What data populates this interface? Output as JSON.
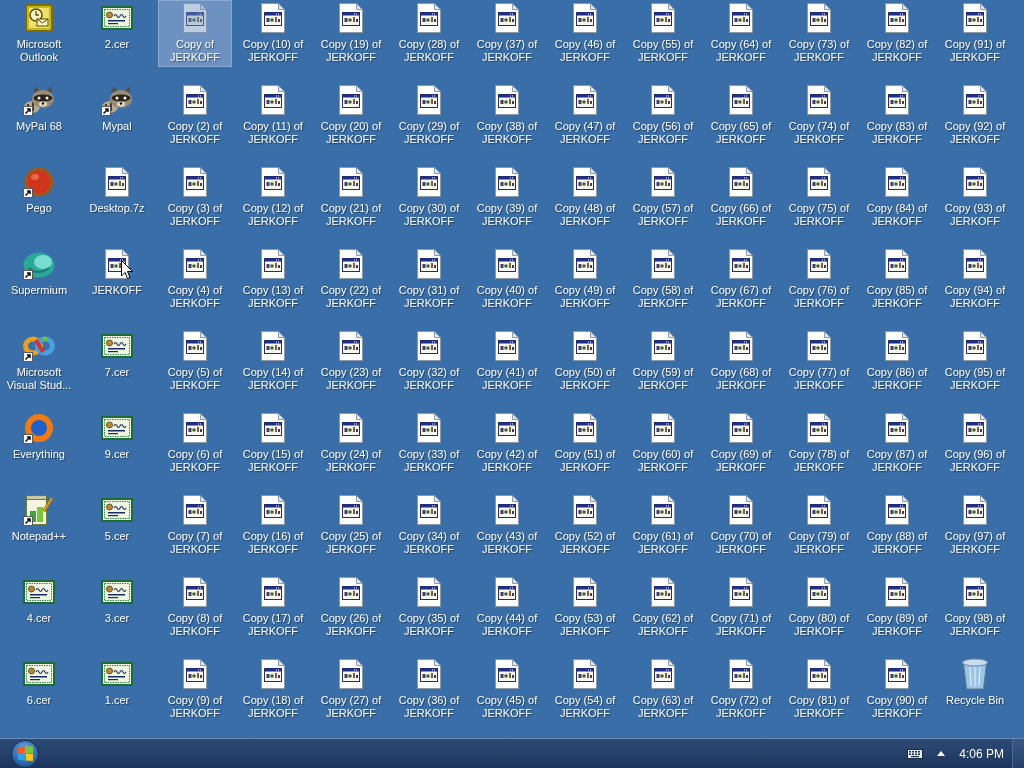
{
  "desktop": {
    "columns": [
      {
        "icons": [
          {
            "label": "Microsoft Outlook",
            "kind": "outlook",
            "shortcut": false,
            "selected": false,
            "pointer": false
          },
          {
            "label": "MyPal 68",
            "kind": "raccoon",
            "shortcut": true,
            "selected": false,
            "pointer": false
          },
          {
            "label": "Pego",
            "kind": "pego",
            "shortcut": true,
            "selected": false,
            "pointer": false
          },
          {
            "label": "Supermium",
            "kind": "supermium",
            "shortcut": true,
            "selected": false,
            "pointer": false
          },
          {
            "label": "Microsoft Visual Stud...",
            "kind": "visualstudio",
            "shortcut": true,
            "selected": false,
            "pointer": false
          },
          {
            "label": "Everything",
            "kind": "everything",
            "shortcut": true,
            "selected": false,
            "pointer": false
          },
          {
            "label": "Notepad++",
            "kind": "notepad",
            "shortcut": true,
            "selected": false,
            "pointer": false
          },
          {
            "label": "4.cer",
            "kind": "certificate",
            "shortcut": false,
            "selected": false,
            "pointer": false
          },
          {
            "label": "6.cer",
            "kind": "certificate",
            "shortcut": false,
            "selected": false,
            "pointer": false
          }
        ]
      },
      {
        "icons": [
          {
            "label": "2.cer",
            "kind": "certificate",
            "shortcut": false,
            "selected": false,
            "pointer": false
          },
          {
            "label": "Mypal",
            "kind": "raccoon",
            "shortcut": true,
            "selected": false,
            "pointer": false
          },
          {
            "label": "Desktop.7z",
            "kind": "program",
            "shortcut": false,
            "selected": false,
            "pointer": false
          },
          {
            "label": "JERKOFF",
            "kind": "program",
            "shortcut": false,
            "selected": false,
            "pointer": true
          },
          {
            "label": "7.cer",
            "kind": "certificate",
            "shortcut": false,
            "selected": false,
            "pointer": false
          },
          {
            "label": "9.cer",
            "kind": "certificate",
            "shortcut": false,
            "selected": false,
            "pointer": false
          },
          {
            "label": "5.cer",
            "kind": "certificate",
            "shortcut": false,
            "selected": false,
            "pointer": false
          },
          {
            "label": "3.cer",
            "kind": "certificate",
            "shortcut": false,
            "selected": false,
            "pointer": false
          },
          {
            "label": "1.cer",
            "kind": "certificate",
            "shortcut": false,
            "selected": false,
            "pointer": false
          }
        ]
      },
      {
        "icons": [
          {
            "label": "Copy of JERKOFF",
            "kind": "program",
            "shortcut": false,
            "selected": true,
            "pointer": false
          },
          {
            "label": "Copy (2) of JERKOFF",
            "kind": "program",
            "shortcut": false,
            "selected": false,
            "pointer": false
          },
          {
            "label": "Copy (3) of JERKOFF",
            "kind": "program",
            "shortcut": false,
            "selected": false,
            "pointer": false
          },
          {
            "label": "Copy (4) of JERKOFF",
            "kind": "program",
            "shortcut": false,
            "selected": false,
            "pointer": false
          },
          {
            "label": "Copy (5) of JERKOFF",
            "kind": "program",
            "shortcut": false,
            "selected": false,
            "pointer": false
          },
          {
            "label": "Copy (6) of JERKOFF",
            "kind": "program",
            "shortcut": false,
            "selected": false,
            "pointer": false
          },
          {
            "label": "Copy (7) of JERKOFF",
            "kind": "program",
            "shortcut": false,
            "selected": false,
            "pointer": false
          },
          {
            "label": "Copy (8) of JERKOFF",
            "kind": "program",
            "shortcut": false,
            "selected": false,
            "pointer": false
          },
          {
            "label": "Copy (9) of JERKOFF",
            "kind": "program",
            "shortcut": false,
            "selected": false,
            "pointer": false
          }
        ]
      },
      {
        "icons": [
          {
            "label": "Copy (10) of JERKOFF",
            "kind": "program",
            "shortcut": false,
            "selected": false,
            "pointer": false
          },
          {
            "label": "Copy (11) of JERKOFF",
            "kind": "program",
            "shortcut": false,
            "selected": false,
            "pointer": false
          },
          {
            "label": "Copy (12) of JERKOFF",
            "kind": "program",
            "shortcut": false,
            "selected": false,
            "pointer": false
          },
          {
            "label": "Copy (13) of JERKOFF",
            "kind": "program",
            "shortcut": false,
            "selected": false,
            "pointer": false
          },
          {
            "label": "Copy (14) of JERKOFF",
            "kind": "program",
            "shortcut": false,
            "selected": false,
            "pointer": false
          },
          {
            "label": "Copy (15) of JERKOFF",
            "kind": "program",
            "shortcut": false,
            "selected": false,
            "pointer": false
          },
          {
            "label": "Copy (16) of JERKOFF",
            "kind": "program",
            "shortcut": false,
            "selected": false,
            "pointer": false
          },
          {
            "label": "Copy (17) of JERKOFF",
            "kind": "program",
            "shortcut": false,
            "selected": false,
            "pointer": false
          },
          {
            "label": "Copy (18) of JERKOFF",
            "kind": "program",
            "shortcut": false,
            "selected": false,
            "pointer": false
          }
        ]
      },
      {
        "icons": [
          {
            "label": "Copy (19) of JERKOFF",
            "kind": "program",
            "shortcut": false,
            "selected": false,
            "pointer": false
          },
          {
            "label": "Copy (20) of JERKOFF",
            "kind": "program",
            "shortcut": false,
            "selected": false,
            "pointer": false
          },
          {
            "label": "Copy (21) of JERKOFF",
            "kind": "program",
            "shortcut": false,
            "selected": false,
            "pointer": false
          },
          {
            "label": "Copy (22) of JERKOFF",
            "kind": "program",
            "shortcut": false,
            "selected": false,
            "pointer": false
          },
          {
            "label": "Copy (23) of JERKOFF",
            "kind": "program",
            "shortcut": false,
            "selected": false,
            "pointer": false
          },
          {
            "label": "Copy (24) of JERKOFF",
            "kind": "program",
            "shortcut": false,
            "selected": false,
            "pointer": false
          },
          {
            "label": "Copy (25) of JERKOFF",
            "kind": "program",
            "shortcut": false,
            "selected": false,
            "pointer": false
          },
          {
            "label": "Copy (26) of JERKOFF",
            "kind": "program",
            "shortcut": false,
            "selected": false,
            "pointer": false
          },
          {
            "label": "Copy (27) of JERKOFF",
            "kind": "program",
            "shortcut": false,
            "selected": false,
            "pointer": false
          }
        ]
      },
      {
        "icons": [
          {
            "label": "Copy (28) of JERKOFF",
            "kind": "program",
            "shortcut": false,
            "selected": false,
            "pointer": false
          },
          {
            "label": "Copy (29) of JERKOFF",
            "kind": "program",
            "shortcut": false,
            "selected": false,
            "pointer": false
          },
          {
            "label": "Copy (30) of JERKOFF",
            "kind": "program",
            "shortcut": false,
            "selected": false,
            "pointer": false
          },
          {
            "label": "Copy (31) of JERKOFF",
            "kind": "program",
            "shortcut": false,
            "selected": false,
            "pointer": false
          },
          {
            "label": "Copy (32) of JERKOFF",
            "kind": "program",
            "shortcut": false,
            "selected": false,
            "pointer": false
          },
          {
            "label": "Copy (33) of JERKOFF",
            "kind": "program",
            "shortcut": false,
            "selected": false,
            "pointer": false
          },
          {
            "label": "Copy (34) of JERKOFF",
            "kind": "program",
            "shortcut": false,
            "selected": false,
            "pointer": false
          },
          {
            "label": "Copy (35) of JERKOFF",
            "kind": "program",
            "shortcut": false,
            "selected": false,
            "pointer": false
          },
          {
            "label": "Copy (36) of JERKOFF",
            "kind": "program",
            "shortcut": false,
            "selected": false,
            "pointer": false
          }
        ]
      },
      {
        "icons": [
          {
            "label": "Copy (37) of JERKOFF",
            "kind": "program",
            "shortcut": false,
            "selected": false,
            "pointer": false
          },
          {
            "label": "Copy (38) of JERKOFF",
            "kind": "program",
            "shortcut": false,
            "selected": false,
            "pointer": false
          },
          {
            "label": "Copy (39) of JERKOFF",
            "kind": "program",
            "shortcut": false,
            "selected": false,
            "pointer": false
          },
          {
            "label": "Copy (40) of JERKOFF",
            "kind": "program",
            "shortcut": false,
            "selected": false,
            "pointer": false
          },
          {
            "label": "Copy (41) of JERKOFF",
            "kind": "program",
            "shortcut": false,
            "selected": false,
            "pointer": false
          },
          {
            "label": "Copy (42) of JERKOFF",
            "kind": "program",
            "shortcut": false,
            "selected": false,
            "pointer": false
          },
          {
            "label": "Copy (43) of JERKOFF",
            "kind": "program",
            "shortcut": false,
            "selected": false,
            "pointer": false
          },
          {
            "label": "Copy (44) of JERKOFF",
            "kind": "program",
            "shortcut": false,
            "selected": false,
            "pointer": false
          },
          {
            "label": "Copy (45) of JERKOFF",
            "kind": "program",
            "shortcut": false,
            "selected": false,
            "pointer": false
          }
        ]
      },
      {
        "icons": [
          {
            "label": "Copy (46) of JERKOFF",
            "kind": "program",
            "shortcut": false,
            "selected": false,
            "pointer": false
          },
          {
            "label": "Copy (47) of JERKOFF",
            "kind": "program",
            "shortcut": false,
            "selected": false,
            "pointer": false
          },
          {
            "label": "Copy (48) of JERKOFF",
            "kind": "program",
            "shortcut": false,
            "selected": false,
            "pointer": false
          },
          {
            "label": "Copy (49) of JERKOFF",
            "kind": "program",
            "shortcut": false,
            "selected": false,
            "pointer": false
          },
          {
            "label": "Copy (50) of JERKOFF",
            "kind": "program",
            "shortcut": false,
            "selected": false,
            "pointer": false
          },
          {
            "label": "Copy (51) of JERKOFF",
            "kind": "program",
            "shortcut": false,
            "selected": false,
            "pointer": false
          },
          {
            "label": "Copy (52) of JERKOFF",
            "kind": "program",
            "shortcut": false,
            "selected": false,
            "pointer": false
          },
          {
            "label": "Copy (53) of JERKOFF",
            "kind": "program",
            "shortcut": false,
            "selected": false,
            "pointer": false
          },
          {
            "label": "Copy (54) of JERKOFF",
            "kind": "program",
            "shortcut": false,
            "selected": false,
            "pointer": false
          }
        ]
      },
      {
        "icons": [
          {
            "label": "Copy (55) of JERKOFF",
            "kind": "program",
            "shortcut": false,
            "selected": false,
            "pointer": false
          },
          {
            "label": "Copy (56) of JERKOFF",
            "kind": "program",
            "shortcut": false,
            "selected": false,
            "pointer": false
          },
          {
            "label": "Copy (57) of JERKOFF",
            "kind": "program",
            "shortcut": false,
            "selected": false,
            "pointer": false
          },
          {
            "label": "Copy (58) of JERKOFF",
            "kind": "program",
            "shortcut": false,
            "selected": false,
            "pointer": false
          },
          {
            "label": "Copy (59) of JERKOFF",
            "kind": "program",
            "shortcut": false,
            "selected": false,
            "pointer": false
          },
          {
            "label": "Copy (60) of JERKOFF",
            "kind": "program",
            "shortcut": false,
            "selected": false,
            "pointer": false
          },
          {
            "label": "Copy (61) of JERKOFF",
            "kind": "program",
            "shortcut": false,
            "selected": false,
            "pointer": false
          },
          {
            "label": "Copy (62) of JERKOFF",
            "kind": "program",
            "shortcut": false,
            "selected": false,
            "pointer": false
          },
          {
            "label": "Copy (63) of JERKOFF",
            "kind": "program",
            "shortcut": false,
            "selected": false,
            "pointer": false
          }
        ]
      },
      {
        "icons": [
          {
            "label": "Copy (64) of JERKOFF",
            "kind": "program",
            "shortcut": false,
            "selected": false,
            "pointer": false
          },
          {
            "label": "Copy (65) of JERKOFF",
            "kind": "program",
            "shortcut": false,
            "selected": false,
            "pointer": false
          },
          {
            "label": "Copy (66) of JERKOFF",
            "kind": "program",
            "shortcut": false,
            "selected": false,
            "pointer": false
          },
          {
            "label": "Copy (67) of JERKOFF",
            "kind": "program",
            "shortcut": false,
            "selected": false,
            "pointer": false
          },
          {
            "label": "Copy (68) of JERKOFF",
            "kind": "program",
            "shortcut": false,
            "selected": false,
            "pointer": false
          },
          {
            "label": "Copy (69) of JERKOFF",
            "kind": "program",
            "shortcut": false,
            "selected": false,
            "pointer": false
          },
          {
            "label": "Copy (70) of JERKOFF",
            "kind": "program",
            "shortcut": false,
            "selected": false,
            "pointer": false
          },
          {
            "label": "Copy (71) of JERKOFF",
            "kind": "program",
            "shortcut": false,
            "selected": false,
            "pointer": false
          },
          {
            "label": "Copy (72) of JERKOFF",
            "kind": "program",
            "shortcut": false,
            "selected": false,
            "pointer": false
          }
        ]
      },
      {
        "icons": [
          {
            "label": "Copy (73) of JERKOFF",
            "kind": "program",
            "shortcut": false,
            "selected": false,
            "pointer": false
          },
          {
            "label": "Copy (74) of JERKOFF",
            "kind": "program",
            "shortcut": false,
            "selected": false,
            "pointer": false
          },
          {
            "label": "Copy (75) of JERKOFF",
            "kind": "program",
            "shortcut": false,
            "selected": false,
            "pointer": false
          },
          {
            "label": "Copy (76) of JERKOFF",
            "kind": "program",
            "shortcut": false,
            "selected": false,
            "pointer": false
          },
          {
            "label": "Copy (77) of JERKOFF",
            "kind": "program",
            "shortcut": false,
            "selected": false,
            "pointer": false
          },
          {
            "label": "Copy (78) of JERKOFF",
            "kind": "program",
            "shortcut": false,
            "selected": false,
            "pointer": false
          },
          {
            "label": "Copy (79) of JERKOFF",
            "kind": "program",
            "shortcut": false,
            "selected": false,
            "pointer": false
          },
          {
            "label": "Copy (80) of JERKOFF",
            "kind": "program",
            "shortcut": false,
            "selected": false,
            "pointer": false
          },
          {
            "label": "Copy (81) of JERKOFF",
            "kind": "program",
            "shortcut": false,
            "selected": false,
            "pointer": false
          }
        ]
      },
      {
        "icons": [
          {
            "label": "Copy (82) of JERKOFF",
            "kind": "program",
            "shortcut": false,
            "selected": false,
            "pointer": false
          },
          {
            "label": "Copy (83) of JERKOFF",
            "kind": "program",
            "shortcut": false,
            "selected": false,
            "pointer": false
          },
          {
            "label": "Copy (84) of JERKOFF",
            "kind": "program",
            "shortcut": false,
            "selected": false,
            "pointer": false
          },
          {
            "label": "Copy (85) of JERKOFF",
            "kind": "program",
            "shortcut": false,
            "selected": false,
            "pointer": false
          },
          {
            "label": "Copy (86) of JERKOFF",
            "kind": "program",
            "shortcut": false,
            "selected": false,
            "pointer": false
          },
          {
            "label": "Copy (87) of JERKOFF",
            "kind": "program",
            "shortcut": false,
            "selected": false,
            "pointer": false
          },
          {
            "label": "Copy (88) of JERKOFF",
            "kind": "program",
            "shortcut": false,
            "selected": false,
            "pointer": false
          },
          {
            "label": "Copy (89) of JERKOFF",
            "kind": "program",
            "shortcut": false,
            "selected": false,
            "pointer": false
          },
          {
            "label": "Copy (90) of JERKOFF",
            "kind": "program",
            "shortcut": false,
            "selected": false,
            "pointer": false
          }
        ]
      },
      {
        "icons": [
          {
            "label": "Copy (91) of JERKOFF",
            "kind": "program",
            "shortcut": false,
            "selected": false,
            "pointer": false
          },
          {
            "label": "Copy (92) of JERKOFF",
            "kind": "program",
            "shortcut": false,
            "selected": false,
            "pointer": false
          },
          {
            "label": "Copy (93) of JERKOFF",
            "kind": "program",
            "shortcut": false,
            "selected": false,
            "pointer": false
          },
          {
            "label": "Copy (94) of JERKOFF",
            "kind": "program",
            "shortcut": false,
            "selected": false,
            "pointer": false
          },
          {
            "label": "Copy (95) of JERKOFF",
            "kind": "program",
            "shortcut": false,
            "selected": false,
            "pointer": false
          },
          {
            "label": "Copy (96) of JERKOFF",
            "kind": "program",
            "shortcut": false,
            "selected": false,
            "pointer": false
          },
          {
            "label": "Copy (97) of JERKOFF",
            "kind": "program",
            "shortcut": false,
            "selected": false,
            "pointer": false
          },
          {
            "label": "Copy (98) of JERKOFF",
            "kind": "program",
            "shortcut": false,
            "selected": false,
            "pointer": false
          },
          {
            "label": "Recycle Bin",
            "kind": "recyclebin",
            "shortcut": false,
            "selected": false,
            "pointer": false
          }
        ]
      }
    ]
  },
  "taskbar": {
    "clock": "4:06 PM"
  }
}
